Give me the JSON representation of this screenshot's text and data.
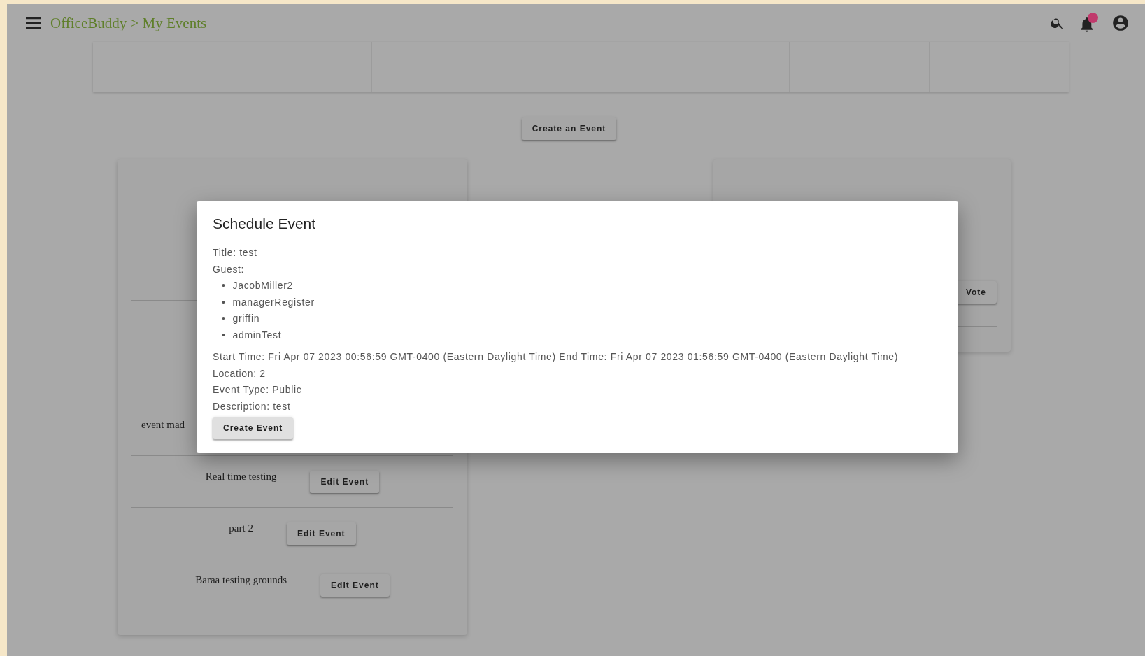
{
  "header": {
    "breadcrumb": "OfficeBuddy > My Events"
  },
  "create_button": "Create an Event",
  "events_card": {
    "rows": [
      {
        "title": "event mad"
      },
      {
        "title": "Real time testing",
        "button": "Edit Event"
      },
      {
        "title": "part 2",
        "button": "Edit Event"
      },
      {
        "title": "Baraa testing grounds",
        "button": "Edit Event"
      }
    ]
  },
  "vote_card": {
    "button": "Vote"
  },
  "modal": {
    "title": "Schedule Event",
    "intro": [
      "Title: test",
      "Guest:"
    ],
    "guests": [
      {
        "bullet": "•",
        "name": "JacobMiller2"
      },
      {
        "bullet": "•",
        "name": "managerRegister"
      },
      {
        "bullet": "•",
        "name": "griffin"
      },
      {
        "bullet": "•",
        "name": "adminTest"
      }
    ],
    "details": [
      "Start Time: Fri Apr 07 2023 00:56:59 GMT-0400 (Eastern Daylight Time) End Time: Fri Apr 07 2023 01:56:59 GMT-0400 (Eastern Daylight Time)",
      "Location: 2",
      "Event Type: Public",
      "Description: test"
    ],
    "button": "Create Event"
  }
}
